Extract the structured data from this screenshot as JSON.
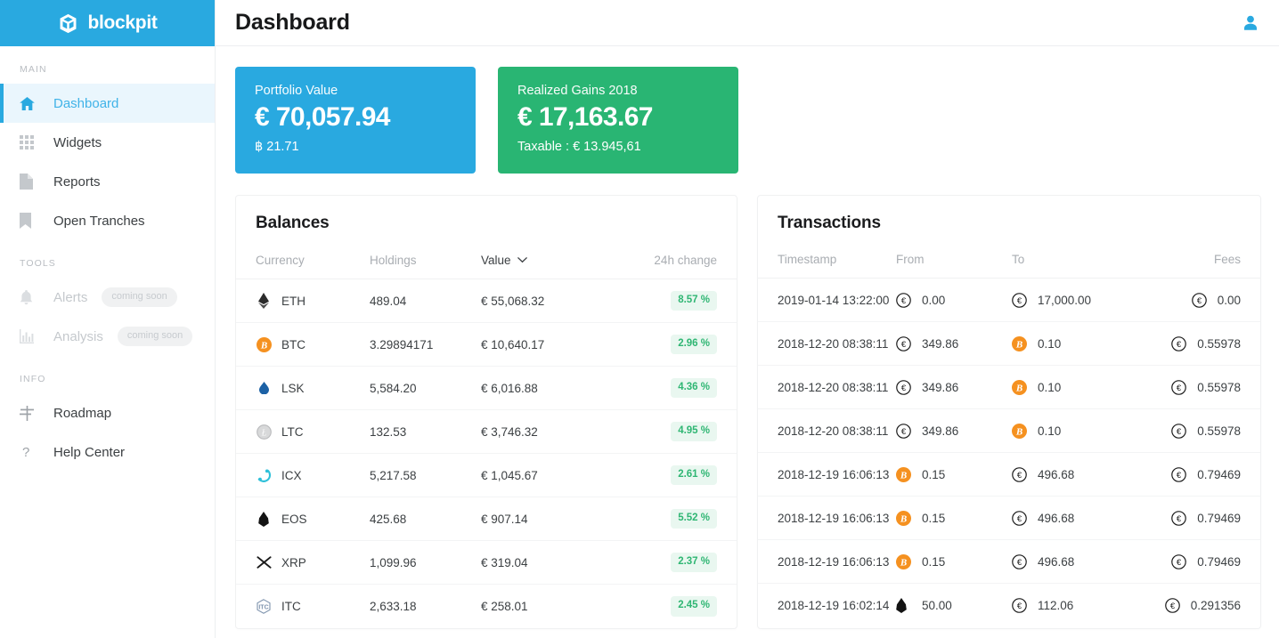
{
  "brand": {
    "name": "blockpit",
    "logo_icon": "cube-logo-icon",
    "color": "#29a9e0"
  },
  "sidebar": {
    "sections": [
      {
        "label": "MAIN",
        "items": [
          {
            "label": "Dashboard",
            "icon": "home-icon",
            "active": true
          },
          {
            "label": "Widgets",
            "icon": "grid-icon",
            "active": false
          },
          {
            "label": "Reports",
            "icon": "document-icon",
            "active": false
          },
          {
            "label": "Open Tranches",
            "icon": "bookmark-icon",
            "active": false
          }
        ]
      },
      {
        "label": "TOOLS",
        "items": [
          {
            "label": "Alerts",
            "icon": "bell-icon",
            "badge": "coming soon",
            "disabled": true
          },
          {
            "label": "Analysis",
            "icon": "bar-chart-icon",
            "badge": "coming soon",
            "disabled": true
          }
        ]
      },
      {
        "label": "INFO",
        "items": [
          {
            "label": "Roadmap",
            "icon": "signpost-icon",
            "active": false
          },
          {
            "label": "Help Center",
            "icon": "question-mark-icon",
            "active": false
          }
        ]
      }
    ]
  },
  "header": {
    "title": "Dashboard",
    "user_icon": "user-avatar-icon"
  },
  "stats": [
    {
      "label": "Portfolio Value",
      "value": "€ 70,057.94",
      "sub": "฿ 21.71",
      "color": "#29a9e0"
    },
    {
      "label": "Realized Gains 2018",
      "value": "€ 17,163.67",
      "sub": "Taxable : € 13.945,61",
      "color": "#29b573"
    }
  ],
  "balances": {
    "title": "Balances",
    "columns": [
      "Currency",
      "Holdings",
      "Value",
      "24h change"
    ],
    "sorted_column": "Value",
    "sort_icon": "chevron-down-icon",
    "rows": [
      {
        "icon": "eth-icon",
        "currency": "ETH",
        "holdings": "489.04",
        "value": "€ 55,068.32",
        "change": "8.57 %"
      },
      {
        "icon": "btc-icon",
        "currency": "BTC",
        "holdings": "3.29894171",
        "value": "€ 10,640.17",
        "change": "2.96 %"
      },
      {
        "icon": "lsk-icon",
        "currency": "LSK",
        "holdings": "5,584.20",
        "value": "€ 6,016.88",
        "change": "4.36 %"
      },
      {
        "icon": "ltc-icon",
        "currency": "LTC",
        "holdings": "132.53",
        "value": "€ 3,746.32",
        "change": "4.95 %"
      },
      {
        "icon": "icx-icon",
        "currency": "ICX",
        "holdings": "5,217.58",
        "value": "€ 1,045.67",
        "change": "2.61 %"
      },
      {
        "icon": "eos-icon",
        "currency": "EOS",
        "holdings": "425.68",
        "value": "€ 907.14",
        "change": "5.52 %"
      },
      {
        "icon": "xrp-icon",
        "currency": "XRP",
        "holdings": "1,099.96",
        "value": "€ 319.04",
        "change": "2.37 %"
      },
      {
        "icon": "itc-icon",
        "currency": "ITC",
        "holdings": "2,633.18",
        "value": "€ 258.01",
        "change": "2.45 %"
      }
    ]
  },
  "transactions": {
    "title": "Transactions",
    "columns": [
      "Timestamp",
      "From",
      "To",
      "Fees"
    ],
    "rows": [
      {
        "timestamp": "2019-01-14 13:22:00",
        "from_icon": "eur-icon",
        "from": "0.00",
        "to_icon": "eur-icon",
        "to": "17,000.00",
        "fee_icon": "eur-icon",
        "fee": "0.00"
      },
      {
        "timestamp": "2018-12-20 08:38:11",
        "from_icon": "eur-icon",
        "from": "349.86",
        "to_icon": "btc-icon",
        "to": "0.10",
        "fee_icon": "eur-icon",
        "fee": "0.55978"
      },
      {
        "timestamp": "2018-12-20 08:38:11",
        "from_icon": "eur-icon",
        "from": "349.86",
        "to_icon": "btc-icon",
        "to": "0.10",
        "fee_icon": "eur-icon",
        "fee": "0.55978"
      },
      {
        "timestamp": "2018-12-20 08:38:11",
        "from_icon": "eur-icon",
        "from": "349.86",
        "to_icon": "btc-icon",
        "to": "0.10",
        "fee_icon": "eur-icon",
        "fee": "0.55978"
      },
      {
        "timestamp": "2018-12-19 16:06:13",
        "from_icon": "btc-icon",
        "from": "0.15",
        "to_icon": "eur-icon",
        "to": "496.68",
        "fee_icon": "eur-icon",
        "fee": "0.79469"
      },
      {
        "timestamp": "2018-12-19 16:06:13",
        "from_icon": "btc-icon",
        "from": "0.15",
        "to_icon": "eur-icon",
        "to": "496.68",
        "fee_icon": "eur-icon",
        "fee": "0.79469"
      },
      {
        "timestamp": "2018-12-19 16:06:13",
        "from_icon": "btc-icon",
        "from": "0.15",
        "to_icon": "eur-icon",
        "to": "496.68",
        "fee_icon": "eur-icon",
        "fee": "0.79469"
      },
      {
        "timestamp": "2018-12-19 16:02:14",
        "from_icon": "eos-icon",
        "from": "50.00",
        "to_icon": "eur-icon",
        "to": "112.06",
        "fee_icon": "eur-icon",
        "fee": "0.291356"
      }
    ]
  },
  "colors": {
    "accent_blue": "#29a9e0",
    "accent_green": "#29b573",
    "badge_green_bg": "#e9f7f0",
    "badge_green_text": "#2fb673",
    "btc_orange": "#f59120"
  }
}
